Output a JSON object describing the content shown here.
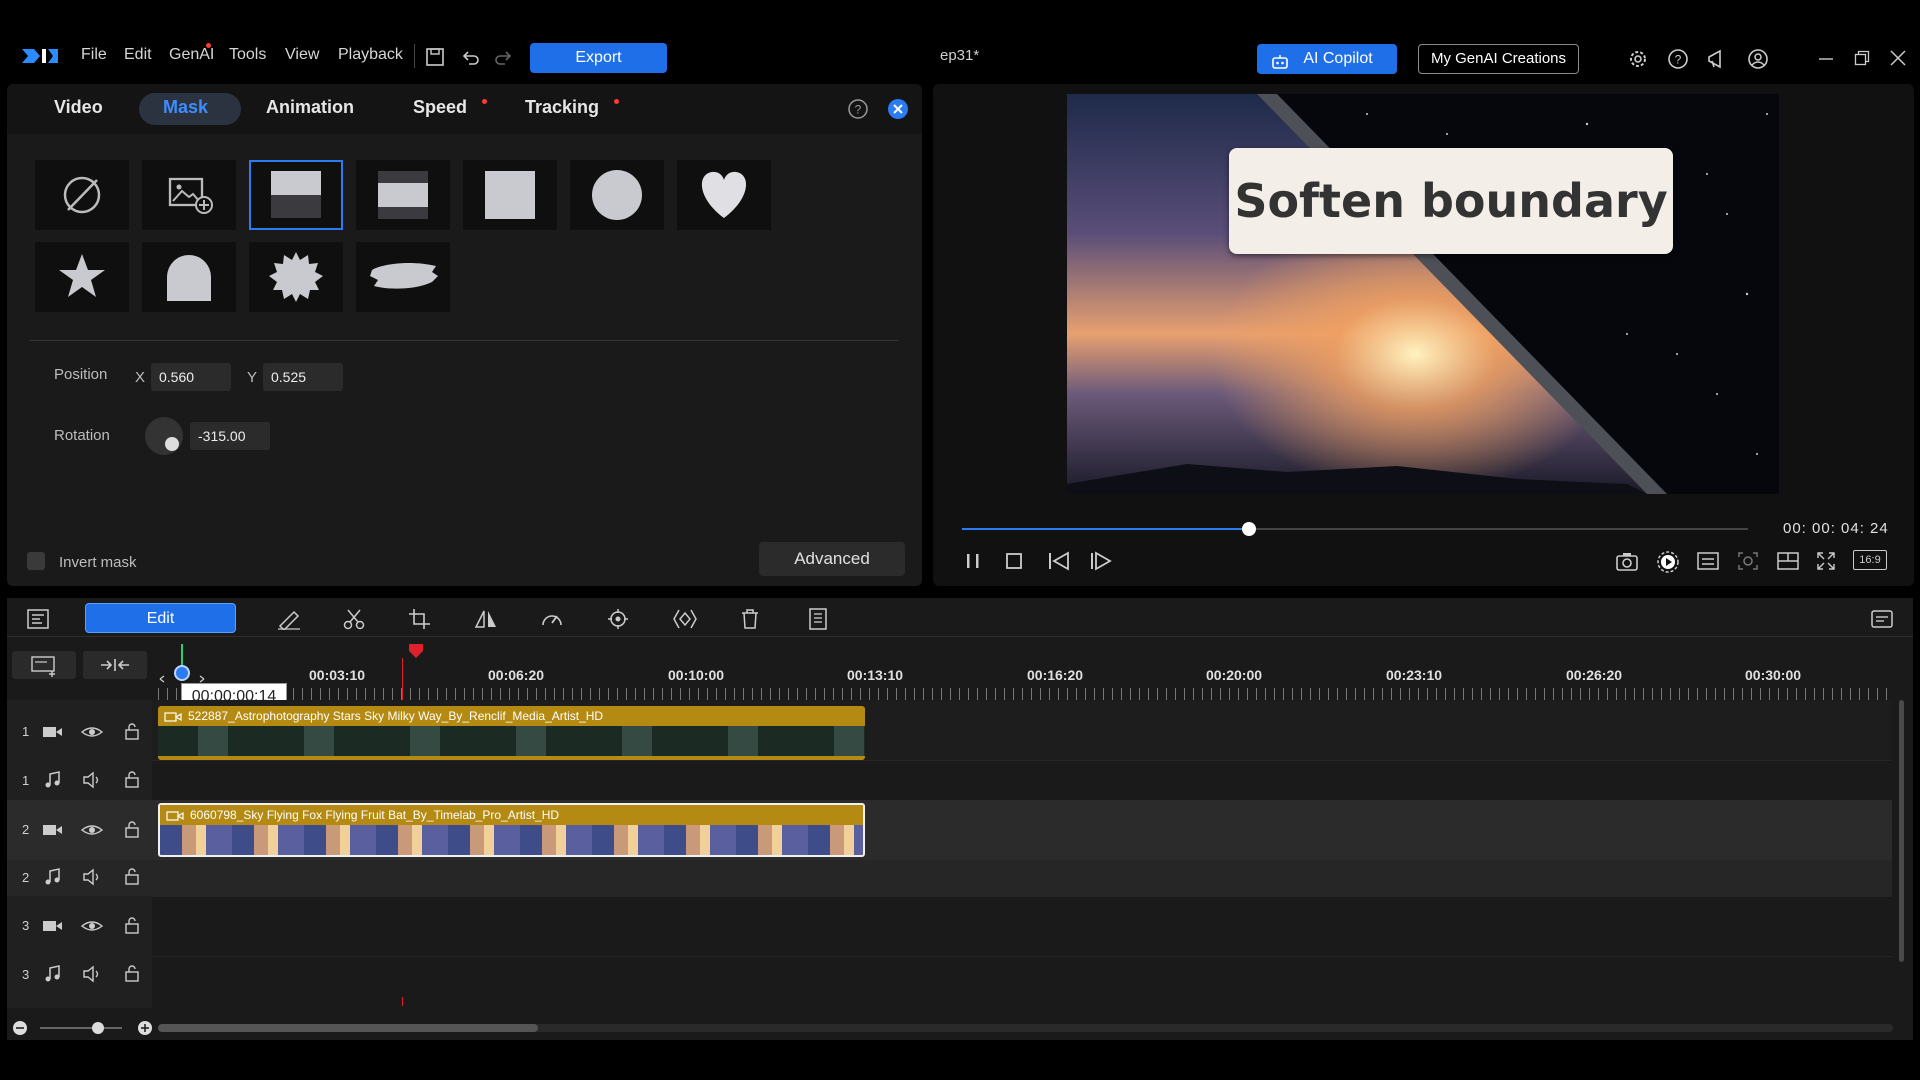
{
  "menu": {
    "file": "File",
    "edit": "Edit",
    "genai": "GenAI",
    "tools": "Tools",
    "view": "View",
    "playback": "Playback"
  },
  "export_label": "Export",
  "project_title": "ep31*",
  "ai_copilot_label": "AI Copilot",
  "my_genai_label": "My GenAI Creations",
  "tabs": {
    "video": "Video",
    "mask": "Mask",
    "animation": "Animation",
    "speed": "Speed",
    "tracking": "Tracking"
  },
  "position": {
    "label": "Position",
    "x_label": "X",
    "x_value": "0.560",
    "y_label": "Y",
    "y_value": "0.525"
  },
  "rotation": {
    "label": "Rotation",
    "value": "-315.00"
  },
  "invert_mask_label": "Invert mask",
  "advanced_label": "Advanced",
  "preview": {
    "caption": "Soften boundary",
    "timecode": "00: 00: 04: 24",
    "aspect": "16:9",
    "progress": 0.365
  },
  "timeline": {
    "edit_label": "Edit",
    "current_time": "00:00:00:14",
    "ruler": [
      "00:03:10",
      "00:06:20",
      "00:10:00",
      "00:13:10",
      "00:16:20",
      "00:20:00",
      "00:23:10",
      "00:26:20",
      "00:30:00"
    ],
    "tracks": [
      "1",
      "1",
      "2",
      "2",
      "3",
      "3"
    ],
    "clip1": "522887_Astrophotography Stars Sky Milky Way_By_Renclif_Media_Artist_HD",
    "clip2": "6060798_Sky Flying Fox Flying Fruit Bat_By_Timelab_Pro_Artist_HD"
  },
  "colors": {
    "accent": "#1e6fe8",
    "clip": "#b58a12",
    "playhead": "#e0202a"
  }
}
